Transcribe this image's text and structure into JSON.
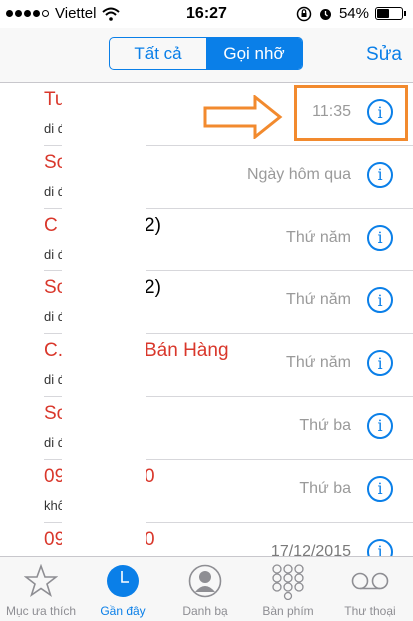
{
  "status_bar": {
    "carrier": "Viettel",
    "time": "16:27",
    "battery_percent": "54%",
    "battery_level": 0.54,
    "signal_bars": 4
  },
  "navbar": {
    "segment_all": "Tất cả",
    "segment_missed": "Gọi nhỡ",
    "edit_label": "Sửa"
  },
  "recents": [
    {
      "name": "Tu",
      "name_tail": "",
      "sub": "di đ",
      "when": "11:35"
    },
    {
      "name": "Sơ",
      "name_tail": "",
      "sub": "di đ",
      "when": "Ngày hôm qua"
    },
    {
      "name": "C",
      "name_tail": "2)",
      "sub": "di đ",
      "when": "Thứ năm"
    },
    {
      "name": "Sơ",
      "name_tail": "2)",
      "sub": "di đ",
      "when": "Thứ năm"
    },
    {
      "name": "C.",
      "name_tail": "Bán Hàng",
      "sub": "di đ",
      "when": "Thứ năm"
    },
    {
      "name": "Sơ",
      "name_tail": "",
      "sub": "di đ",
      "when": "Thứ ba"
    },
    {
      "name": "09",
      "name_tail": "0",
      "sub": "khô",
      "when": "Thứ ba"
    },
    {
      "name": "09",
      "name_tail": "0",
      "sub": "",
      "when": "17/12/2015"
    }
  ],
  "info_glyph": "i",
  "tabs": [
    {
      "label": "Mục ưa thích",
      "icon": "star-icon"
    },
    {
      "label": "Gần đây",
      "icon": "clock-icon"
    },
    {
      "label": "Danh bạ",
      "icon": "contacts-icon"
    },
    {
      "label": "Bàn phím",
      "icon": "keypad-icon"
    },
    {
      "label": "Thư thoại",
      "icon": "voicemail-icon"
    }
  ],
  "colors": {
    "accent": "#0a7fe8",
    "missed_call": "#d9372b",
    "annotation": "#f28a2e"
  }
}
